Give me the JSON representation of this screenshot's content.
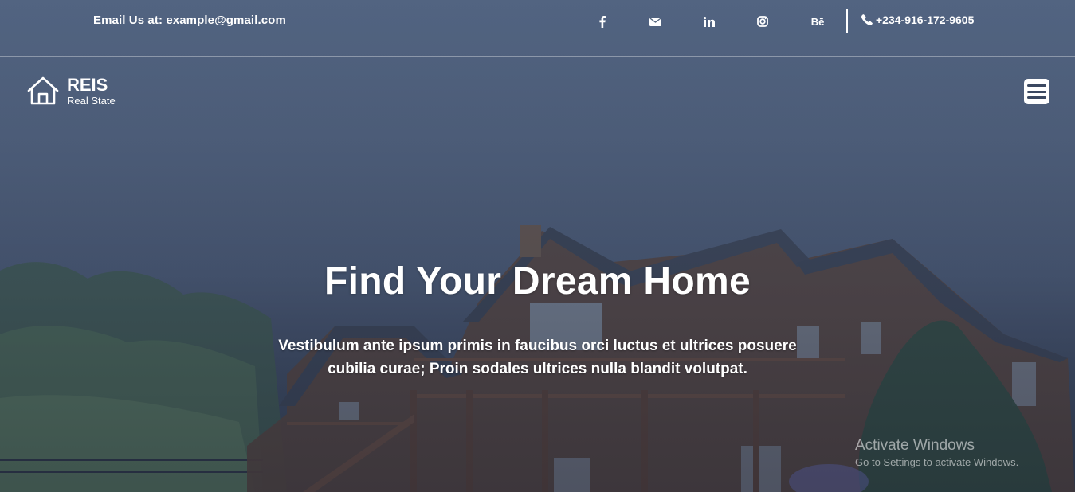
{
  "topbar": {
    "email_text": "Email Us at: example@gmail.com",
    "social": [
      {
        "icon": "facebook-icon",
        "glyph": "f"
      },
      {
        "icon": "envelope-icon",
        "glyph": ""
      },
      {
        "icon": "linkedin-icon",
        "glyph": "in"
      },
      {
        "icon": "instagram-icon",
        "glyph": ""
      },
      {
        "icon": "behance-icon",
        "glyph": "Bē"
      }
    ],
    "phone": "+234-916-172-9605",
    "phone_icon": "phone-icon"
  },
  "navbar": {
    "logo_icon": "house-icon",
    "brand_name": "REIS",
    "brand_tagline": "Real State",
    "menu_icon": "hamburger-menu-icon"
  },
  "hero": {
    "title": "Find Your Dream Home",
    "subtitle": "Vestibulum ante ipsum primis in faucibus orci luctus et ultrices posuere cubilia curae; Proin sodales ultrices nulla blandit volutpat."
  },
  "watermark": {
    "title": "Activate Windows",
    "subtitle": "Go to Settings to activate Windows."
  },
  "colors": {
    "text": "#ffffff",
    "overlay": "#3c4a66",
    "menu_button_bg": "#ffffff",
    "menu_lines": "#3b4861"
  }
}
